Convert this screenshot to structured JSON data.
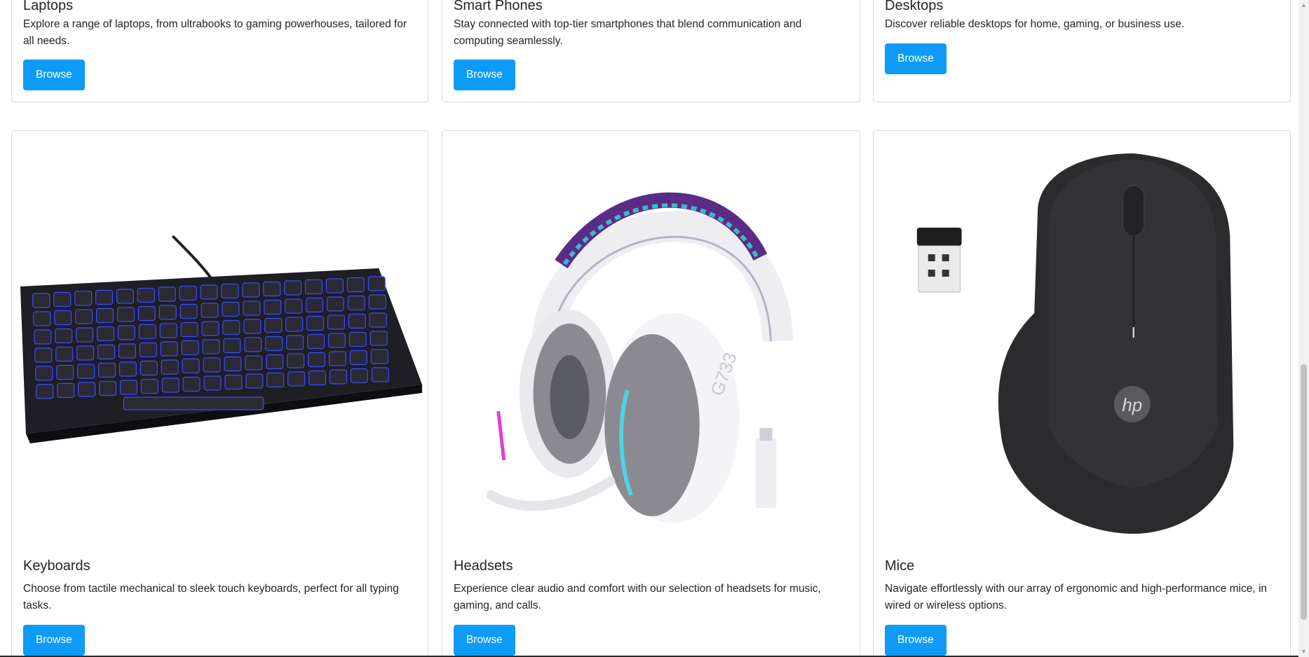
{
  "cards_top": [
    {
      "title": "Laptops",
      "text": "Explore a range of laptops, from ultrabooks to gaming powerhouses, tailored for all needs.",
      "button": "Browse"
    },
    {
      "title": "Smart Phones",
      "text": "Stay connected with top-tier smartphones that blend communication and computing seamlessly.",
      "button": "Browse"
    },
    {
      "title": "Desktops",
      "text": "Discover reliable desktops for home, gaming, or business use.",
      "button": "Browse"
    }
  ],
  "cards_bottom": [
    {
      "title": "Keyboards",
      "text": "Choose from tactile mechanical to sleek touch keyboards, perfect for all typing tasks.",
      "button": "Browse",
      "image_icon": "keyboard-image"
    },
    {
      "title": "Headsets",
      "text": "Experience clear audio and comfort with our selection of headsets for music, gaming, and calls.",
      "button": "Browse",
      "image_icon": "headset-image",
      "image_text": "G733"
    },
    {
      "title": "Mice",
      "text": "Navigate effortlessly with our array of ergonomic and high-performance mice, in wired or wireless options.",
      "button": "Browse",
      "image_icon": "mouse-image",
      "image_text": "hp"
    }
  ],
  "colors": {
    "button": "#0d9bf7",
    "border": "#dcdcdc"
  }
}
